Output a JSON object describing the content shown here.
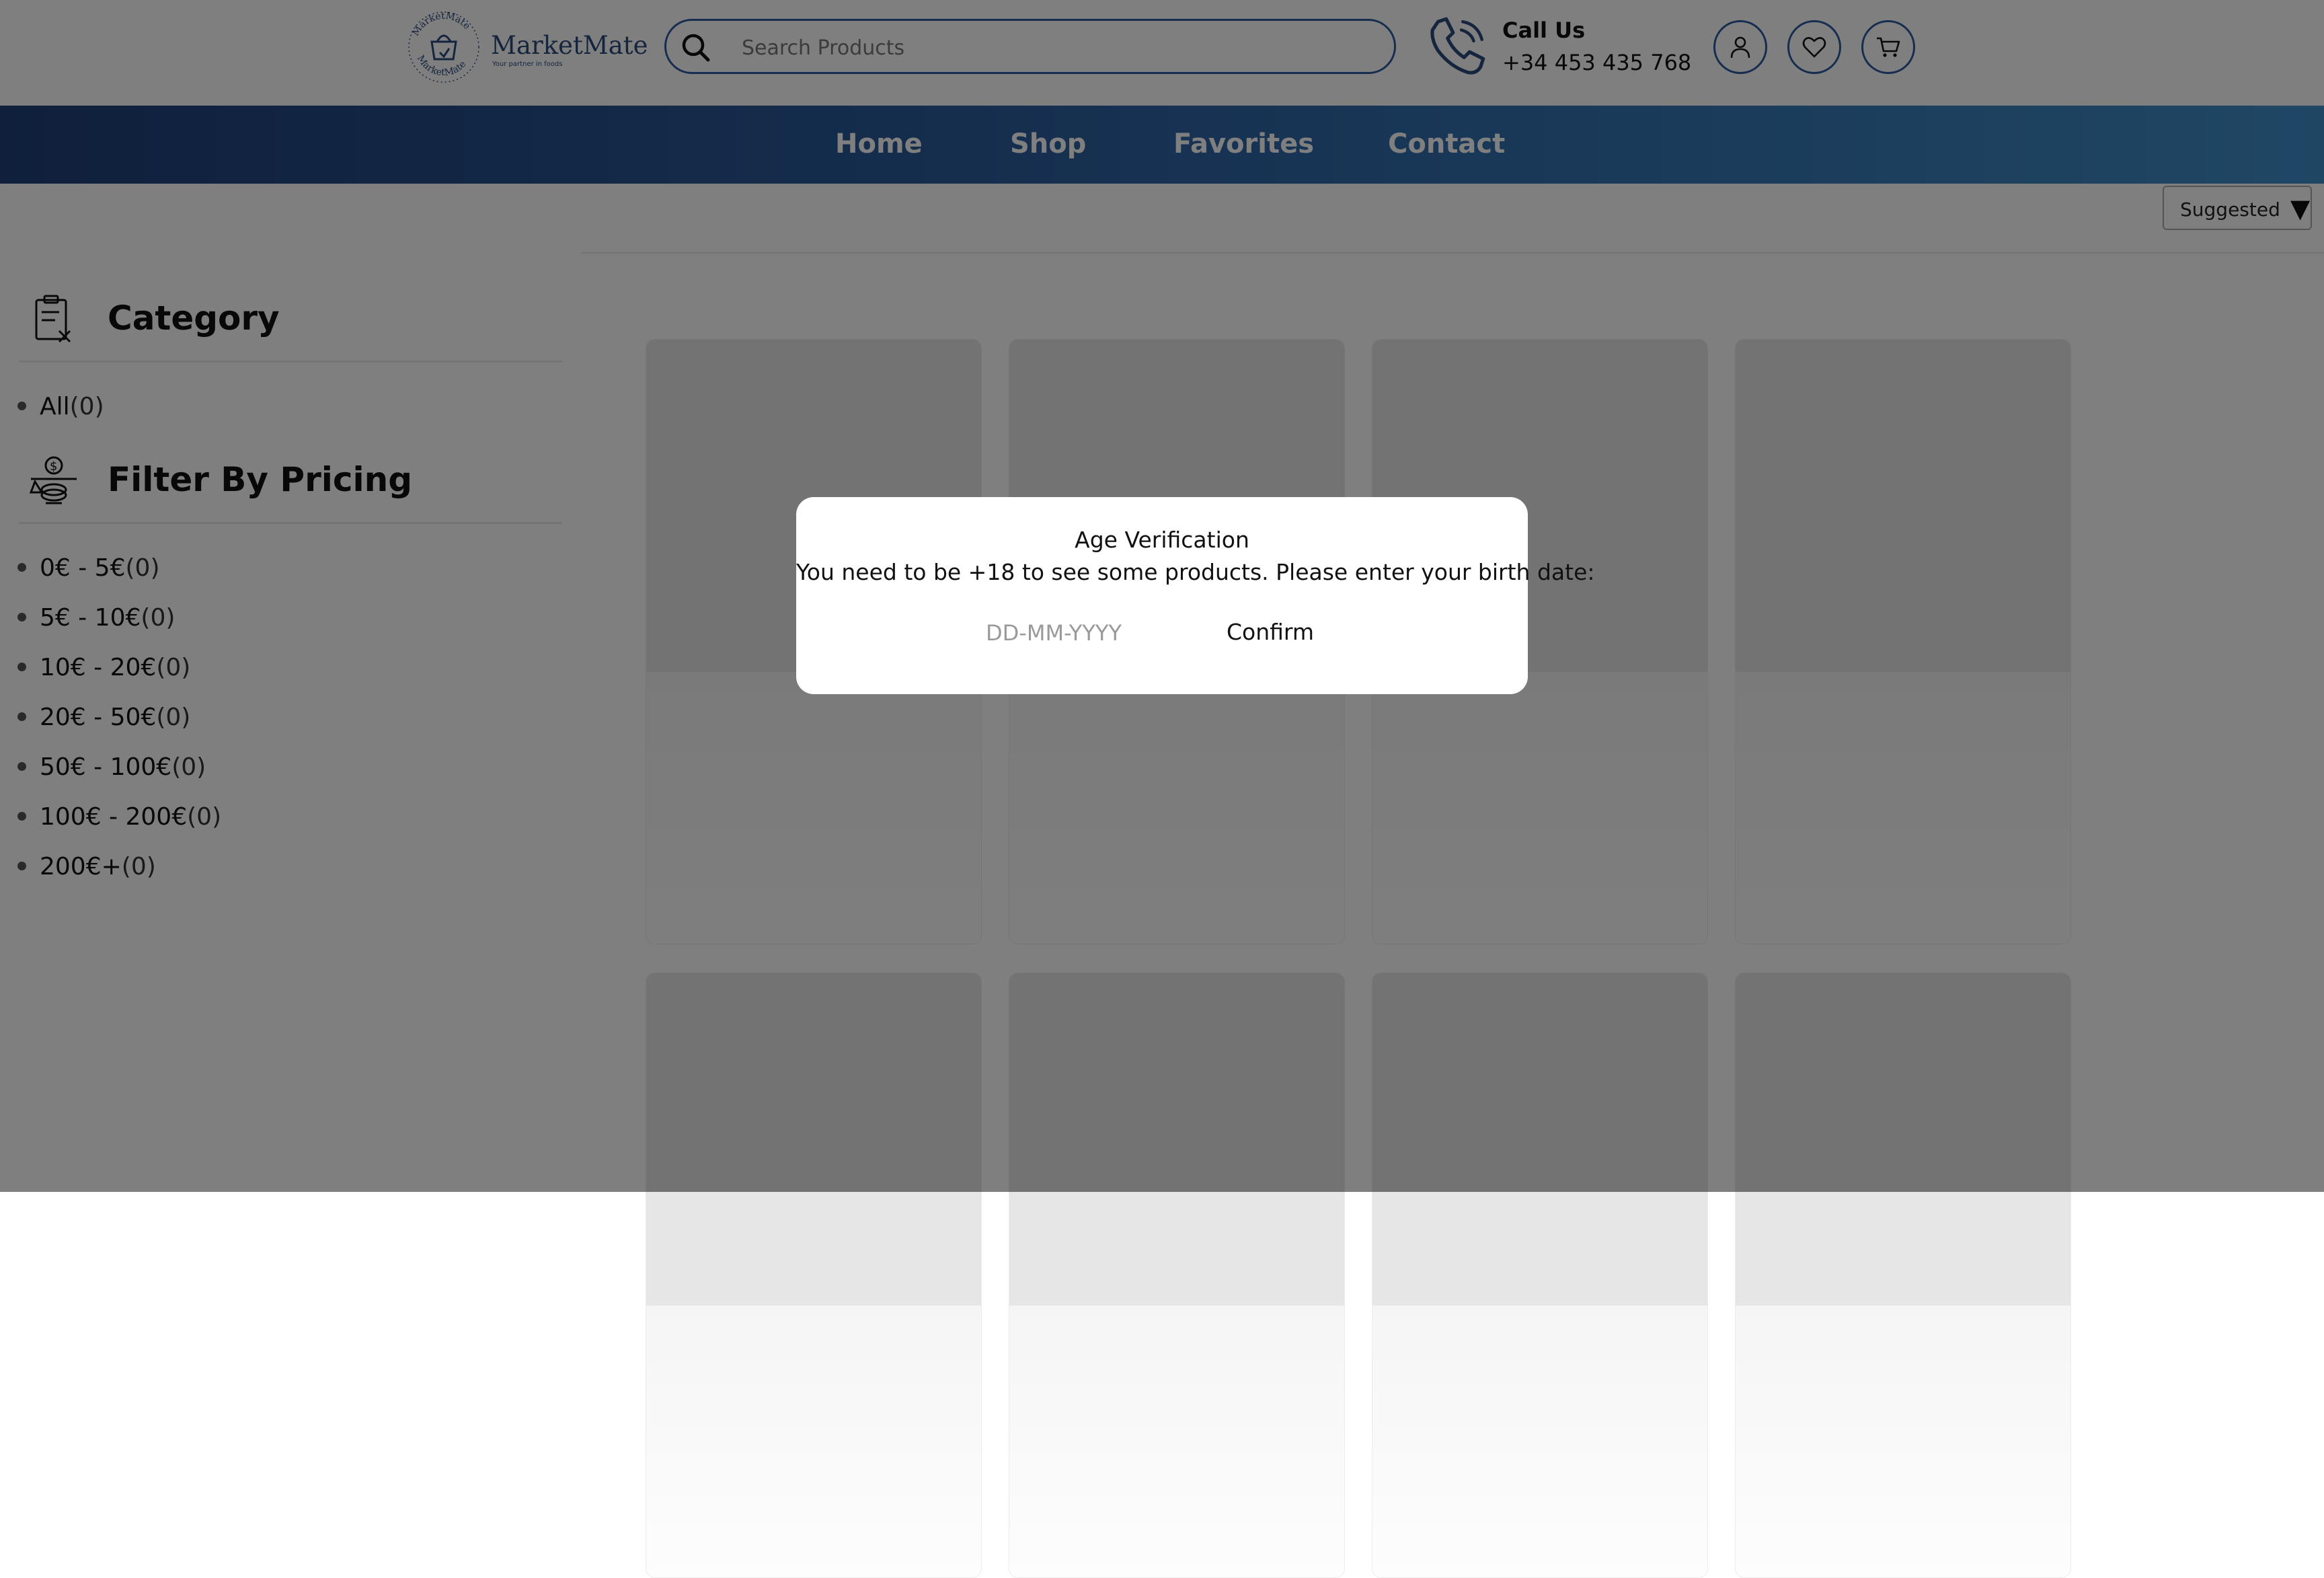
{
  "header": {
    "logo": {
      "name": "MarketMate",
      "tagline": "Your partner in foods",
      "ring_text": "MarketMate"
    },
    "search": {
      "placeholder": "Search Products",
      "value": "",
      "icon": "search-icon"
    },
    "contact": {
      "label": "Call Us",
      "phone": "+34 453 435 768",
      "icon": "phone-icon"
    },
    "actions": [
      {
        "name": "account",
        "icon": "user-icon"
      },
      {
        "name": "favorites",
        "icon": "heart-icon"
      },
      {
        "name": "cart",
        "icon": "cart-icon"
      }
    ]
  },
  "nav": {
    "items": [
      {
        "label": "Home"
      },
      {
        "label": "Shop"
      },
      {
        "label": "Favorites"
      },
      {
        "label": "Contact"
      }
    ]
  },
  "sort": {
    "selected": "Suggested",
    "icon": "caret-down-icon"
  },
  "sidebar": {
    "category": {
      "heading": "Category",
      "icon": "clipboard-icon",
      "items": [
        {
          "label": "All",
          "count": "(0)"
        }
      ]
    },
    "pricing": {
      "heading": "Filter By Pricing",
      "icon": "price-scale-icon",
      "items": [
        {
          "label": "0€ - 5€",
          "count": "(0)"
        },
        {
          "label": "5€ - 10€",
          "count": "(0)"
        },
        {
          "label": "10€ - 20€",
          "count": "(0)"
        },
        {
          "label": "20€ - 50€",
          "count": "(0)"
        },
        {
          "label": "50€ - 100€",
          "count": "(0)"
        },
        {
          "label": "100€ - 200€",
          "count": "(0)"
        },
        {
          "label": "200€+",
          "count": "(0)"
        }
      ]
    }
  },
  "products": {
    "placeholder_cards": 12
  },
  "modal": {
    "title": "Age Verification",
    "message": "You need to be +18 to see some products. Please enter your birth date:",
    "date_placeholder": "DD-MM-YYYY",
    "date_value": "",
    "confirm_label": "Confirm"
  },
  "colors": {
    "brand_blue": "#2f5aa0",
    "nav_gradient_start": "#1f3f78",
    "nav_gradient_end": "#3f8ec9",
    "overlay": "rgba(0,0,0,0.5)"
  }
}
